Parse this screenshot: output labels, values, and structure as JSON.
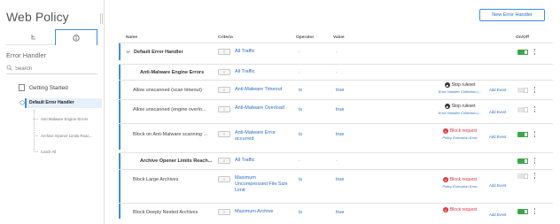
{
  "app": {
    "title": "Web Policy"
  },
  "sidebar": {
    "section_label": "Error Handler",
    "search_placeholder": "Search",
    "getting_started": "Getting Started",
    "selected_item": "Default Error Handler",
    "sub_items": [
      "Anti Malware Engine Errors",
      "Archive Opener Limits Reac...",
      "Catch All"
    ]
  },
  "toolbar": {
    "new_button": "New Error Handler"
  },
  "table": {
    "headers": {
      "name": "Name",
      "criteria": "Criteria",
      "operator": "Operator",
      "value": "Value",
      "onoff": "On/Off"
    },
    "rows": [
      {
        "kind": "group",
        "name": "Default Error Handler",
        "criteria": "All Traffic",
        "operator": "-",
        "value": "-",
        "enabled": true
      },
      {
        "kind": "subgroup",
        "name": "Anti-Malware Engine Errors",
        "criteria": "All Traffic",
        "operator": "-",
        "value": "-"
      },
      {
        "kind": "rule",
        "name": "Allow unscanned (scan timeout)",
        "criteria": "Anti-Malware Timeout",
        "operator": "is",
        "value": "true",
        "action": "Stop ruleset",
        "action_type": "stop",
        "action_sub": "Error Handler Collection (...",
        "add_event": "Add Event",
        "enabled": false
      },
      {
        "kind": "rule",
        "name": "Allow unscanned (engine overlo...",
        "criteria": "Anti-Malware Overload",
        "operator": "is",
        "value": "true",
        "action": "Stop ruleset",
        "action_type": "stop",
        "action_sub": "Error Handler Collection (...",
        "add_event": "Add Event",
        "enabled": false
      },
      {
        "kind": "rule",
        "name": "Block on Anti-Malware scanning ...",
        "criteria": "Anti-Malware Error occurred",
        "operator": "is",
        "value": "true",
        "action": "Block request",
        "action_type": "block",
        "action_sub": "Policy Execution Error",
        "add_event": "Add Event",
        "enabled": true
      },
      {
        "kind": "subgroup",
        "name": "Archive Opener Limits Reach...",
        "criteria": "All Traffic",
        "operator": "-",
        "value": "-",
        "enabled": true
      },
      {
        "kind": "rule",
        "name": "Block Large Archives",
        "criteria": "Maximum Uncompressed File Size Limit",
        "operator": "is",
        "value": "true",
        "action": "Block request",
        "action_type": "block",
        "action_sub": "Policy Execution Error",
        "add_event": "Add Event",
        "enabled": false
      },
      {
        "kind": "rule",
        "name": "Block Deeply Nested Archives",
        "criteria": "Maximum Archive",
        "operator": "is",
        "value": "true",
        "action": "Block request",
        "action_type": "block",
        "action_sub": "",
        "add_event": "Add Event",
        "enabled": true
      }
    ]
  },
  "colors": {
    "accent": "#3d8ee0",
    "link": "#2a6fc4",
    "toggle_on": "#3da54a",
    "block": "#d9363e"
  }
}
